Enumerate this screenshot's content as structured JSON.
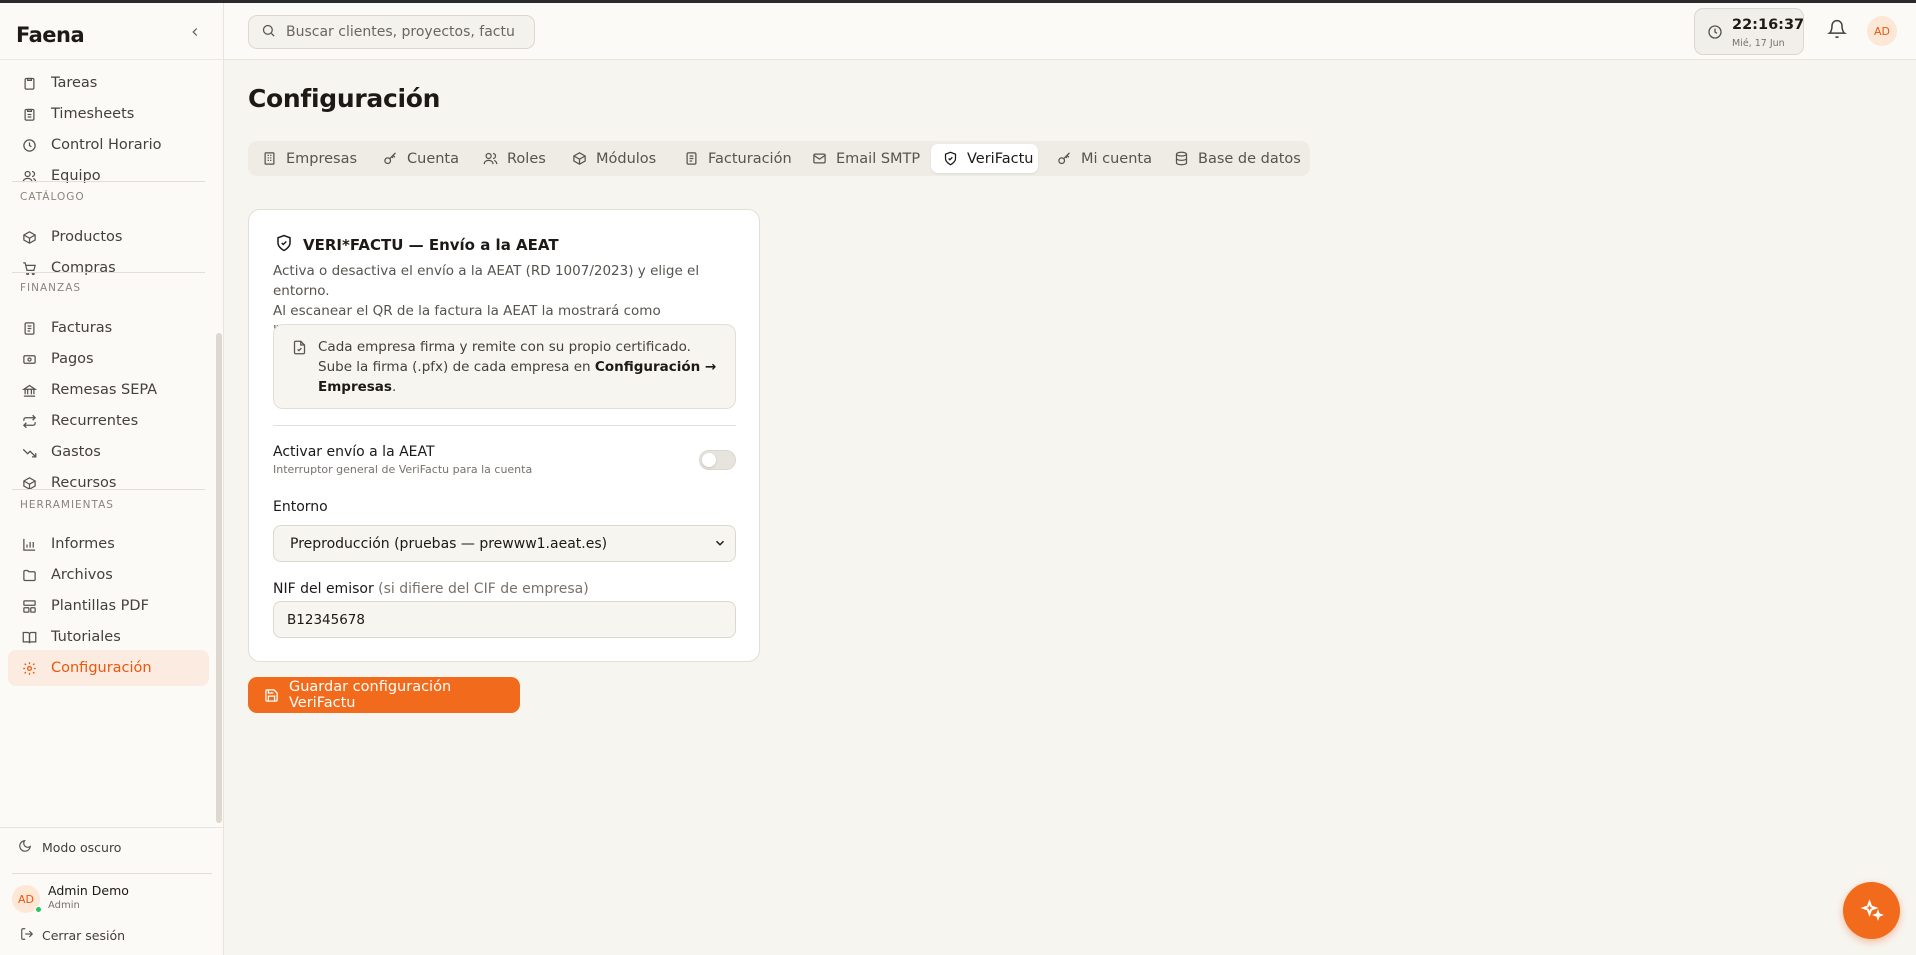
{
  "app": {
    "brand": "Faena",
    "accent": "#f26a1b"
  },
  "sidebar": {
    "groups": [
      {
        "label": "",
        "items": [
          {
            "label": "Tareas",
            "icon": "clipboard-icon"
          },
          {
            "label": "Timesheets",
            "icon": "clipboard-list-icon"
          },
          {
            "label": "Control Horario",
            "icon": "clock-icon"
          },
          {
            "label": "Equipo",
            "icon": "users-icon"
          }
        ]
      },
      {
        "label": "CATÁLOGO",
        "items": [
          {
            "label": "Productos",
            "icon": "package-icon"
          },
          {
            "label": "Compras",
            "icon": "cart-icon"
          }
        ]
      },
      {
        "label": "FINANZAS",
        "items": [
          {
            "label": "Facturas",
            "icon": "invoice-icon"
          },
          {
            "label": "Pagos",
            "icon": "banknote-icon"
          },
          {
            "label": "Remesas SEPA",
            "icon": "bank-icon"
          },
          {
            "label": "Recurrentes",
            "icon": "repeat-icon"
          },
          {
            "label": "Gastos",
            "icon": "trending-down-icon"
          },
          {
            "label": "Recursos",
            "icon": "box-icon"
          }
        ]
      },
      {
        "label": "HERRAMIENTAS",
        "items": [
          {
            "label": "Informes",
            "icon": "bar-chart-icon"
          },
          {
            "label": "Archivos",
            "icon": "folder-icon"
          },
          {
            "label": "Plantillas PDF",
            "icon": "layout-icon"
          },
          {
            "label": "Tutoriales",
            "icon": "book-icon"
          },
          {
            "label": "Configuración",
            "icon": "gear-icon",
            "active": true
          }
        ]
      }
    ],
    "dark_mode": "Modo oscuro",
    "user": {
      "initials": "AD",
      "name": "Admin Demo",
      "role": "Admin"
    },
    "logout": "Cerrar sesión"
  },
  "topbar": {
    "search_placeholder": "Buscar clientes, proyectos, facturas...",
    "clock": {
      "time": "22:16:37",
      "date": "Mié, 17 Jun"
    },
    "avatar": "AD"
  },
  "main": {
    "title": "Configuración",
    "tabs": [
      {
        "label": "Empresas",
        "icon": "building-icon"
      },
      {
        "label": "Cuenta",
        "icon": "key-icon"
      },
      {
        "label": "Roles",
        "icon": "users-icon"
      },
      {
        "label": "Módulos",
        "icon": "package-icon"
      },
      {
        "label": "Facturación",
        "icon": "invoice-icon"
      },
      {
        "label": "Email SMTP",
        "icon": "mail-icon"
      },
      {
        "label": "VeriFactu",
        "icon": "shield-check-icon",
        "active": true
      },
      {
        "label": "Mi cuenta",
        "icon": "key-icon"
      },
      {
        "label": "Base de datos",
        "icon": "database-icon"
      }
    ],
    "card": {
      "title": "VERI*FACTU — Envío a la AEAT",
      "desc_1": "Activa o desactiva el envío a la AEAT (RD 1007/2023) y elige el entorno.",
      "desc_2": "Al escanear el QR de la factura la AEAT la mostrará como \"encontrada\".",
      "info_1": "Cada empresa firma y remite con su propio certificado. Sube la firma (.pfx) de cada empresa en",
      "info_bold": "Configuración → Empresas",
      "info_end": ".",
      "toggle_label": "Activar envío a la AEAT",
      "toggle_sub": "Interruptor general de VeriFactu para la cuenta",
      "toggle_on": false,
      "env_label": "Entorno",
      "env_value": "Preproducción (pruebas — prewww1.aeat.es)",
      "nif_label": "NIF del emisor",
      "nif_hint": "(si difiere del CIF de empresa)",
      "nif_value": "B12345678"
    },
    "save_label": "Guardar configuración VeriFactu"
  }
}
